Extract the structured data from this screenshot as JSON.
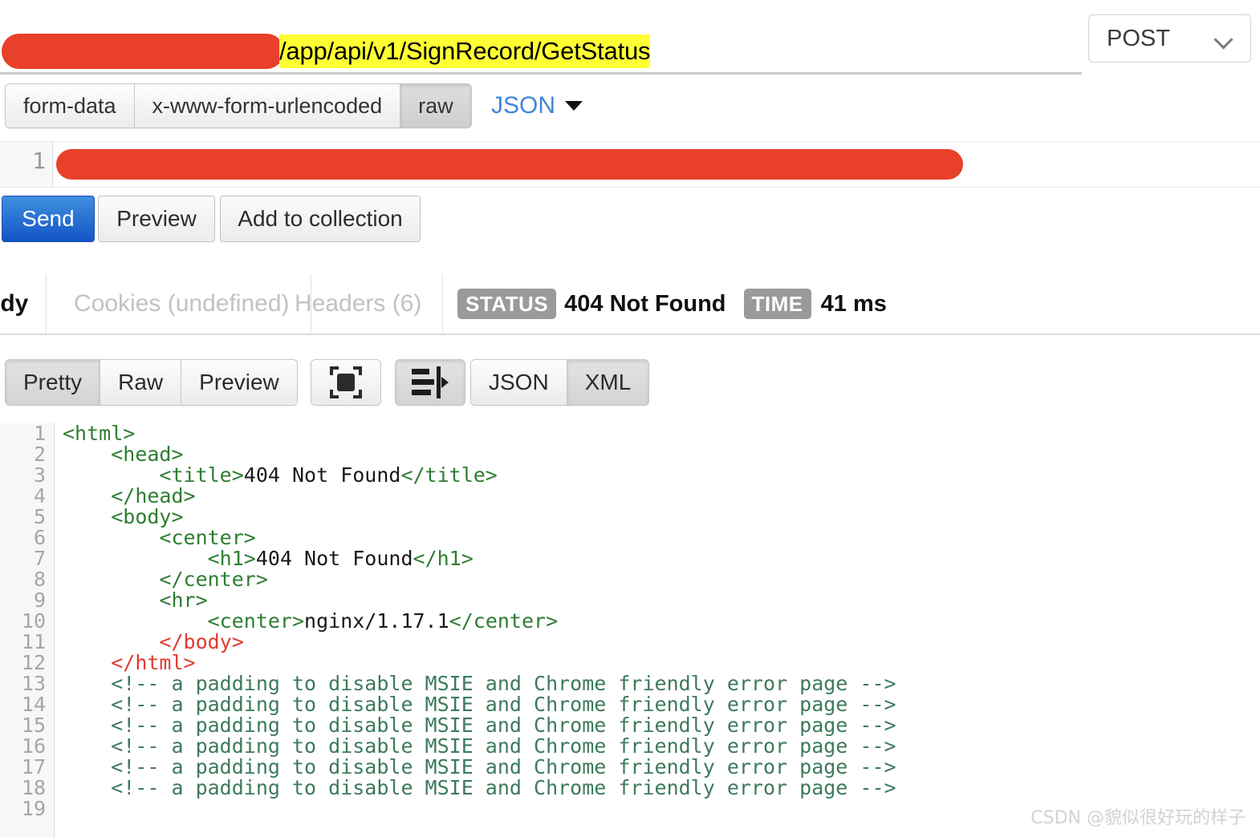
{
  "request": {
    "url_redacted": true,
    "url_visible_text": "/app/api/v1/SignRecord/GetStatus",
    "url_highlight_color": "#ffff33",
    "redaction_color": "#e8402a",
    "method": "POST",
    "method_chevron_icon": "chevron-down-icon",
    "body_type_tabs": [
      {
        "label": "form-data",
        "active": false
      },
      {
        "label": "x-www-form-urlencoded",
        "active": false
      },
      {
        "label": "raw",
        "active": true
      }
    ],
    "raw_format": {
      "label": "JSON",
      "color": "#3f87d8",
      "caret_icon": "caret-down-icon"
    },
    "body_editor": {
      "line_numbers": [
        "1"
      ],
      "content_redacted": true
    },
    "actions": [
      {
        "label": "Send",
        "style": "primary"
      },
      {
        "label": "Preview",
        "style": "secondary"
      },
      {
        "label": "Add to collection",
        "style": "secondary"
      }
    ]
  },
  "response": {
    "tabs": [
      {
        "label": "Body",
        "clipped_label": "ody",
        "active": true,
        "muted": false
      },
      {
        "label": "Cookies (undefined)",
        "active": false,
        "muted": true
      },
      {
        "label": "Headers (6)",
        "active": false,
        "muted": true
      }
    ],
    "status": {
      "badge": "STATUS",
      "value": "404 Not Found",
      "badge_color": "#9a9a9a"
    },
    "time": {
      "badge": "TIME",
      "value": "41 ms",
      "badge_color": "#9a9a9a"
    },
    "toolbar": {
      "view_modes": [
        {
          "label": "Pretty",
          "active": true
        },
        {
          "label": "Raw",
          "active": false
        },
        {
          "label": "Preview",
          "active": false
        }
      ],
      "fullscreen_button": {
        "icon": "fullscreen-icon",
        "active": false
      },
      "wrap_button": {
        "icon": "text-wrap-icon",
        "active": true
      },
      "formats": [
        {
          "label": "JSON",
          "active": false
        },
        {
          "label": "XML",
          "active": true
        }
      ]
    },
    "code": {
      "language": "html",
      "line_numbers": [
        "1",
        "2",
        "3",
        "4",
        "5",
        "6",
        "7",
        "8",
        "9",
        "10",
        "11",
        "12",
        "13",
        "14",
        "15",
        "16",
        "17",
        "18",
        "19"
      ],
      "lines": [
        {
          "n": 1,
          "indent": 0,
          "parts": [
            {
              "t": "tag",
              "s": "<html>"
            }
          ]
        },
        {
          "n": 2,
          "indent": 1,
          "parts": [
            {
              "t": "tag",
              "s": "<head>"
            }
          ]
        },
        {
          "n": 3,
          "indent": 2,
          "parts": [
            {
              "t": "tag",
              "s": "<title>"
            },
            {
              "t": "txt",
              "s": "404 Not Found"
            },
            {
              "t": "tag",
              "s": "</title>"
            }
          ]
        },
        {
          "n": 4,
          "indent": 1,
          "parts": [
            {
              "t": "tag",
              "s": "</head>"
            }
          ]
        },
        {
          "n": 5,
          "indent": 1,
          "parts": [
            {
              "t": "tag",
              "s": "<body>"
            }
          ]
        },
        {
          "n": 6,
          "indent": 2,
          "parts": [
            {
              "t": "tag",
              "s": "<center>"
            }
          ]
        },
        {
          "n": 7,
          "indent": 3,
          "parts": [
            {
              "t": "tag",
              "s": "<h1>"
            },
            {
              "t": "txt",
              "s": "404 Not Found"
            },
            {
              "t": "tag",
              "s": "</h1>"
            }
          ]
        },
        {
          "n": 8,
          "indent": 2,
          "parts": [
            {
              "t": "tag",
              "s": "</center>"
            }
          ]
        },
        {
          "n": 9,
          "indent": 2,
          "parts": [
            {
              "t": "tag",
              "s": "<hr>"
            }
          ]
        },
        {
          "n": 10,
          "indent": 3,
          "parts": [
            {
              "t": "tag",
              "s": "<center>"
            },
            {
              "t": "txt",
              "s": "nginx/1.17.1"
            },
            {
              "t": "tag",
              "s": "</center>"
            }
          ]
        },
        {
          "n": 11,
          "indent": 2,
          "parts": [
            {
              "t": "err",
              "s": "</body>"
            }
          ]
        },
        {
          "n": 12,
          "indent": 1,
          "parts": [
            {
              "t": "err",
              "s": "</html>"
            }
          ]
        },
        {
          "n": 13,
          "indent": 1,
          "parts": [
            {
              "t": "cmt",
              "s": "<!-- a padding to disable MSIE and Chrome friendly error page -->"
            }
          ]
        },
        {
          "n": 14,
          "indent": 1,
          "parts": [
            {
              "t": "cmt",
              "s": "<!-- a padding to disable MSIE and Chrome friendly error page -->"
            }
          ]
        },
        {
          "n": 15,
          "indent": 1,
          "parts": [
            {
              "t": "cmt",
              "s": "<!-- a padding to disable MSIE and Chrome friendly error page -->"
            }
          ]
        },
        {
          "n": 16,
          "indent": 1,
          "parts": [
            {
              "t": "cmt",
              "s": "<!-- a padding to disable MSIE and Chrome friendly error page -->"
            }
          ]
        },
        {
          "n": 17,
          "indent": 1,
          "parts": [
            {
              "t": "cmt",
              "s": "<!-- a padding to disable MSIE and Chrome friendly error page -->"
            }
          ]
        },
        {
          "n": 18,
          "indent": 1,
          "parts": [
            {
              "t": "cmt",
              "s": "<!-- a padding to disable MSIE and Chrome friendly error page -->"
            }
          ]
        },
        {
          "n": 19,
          "indent": 0,
          "parts": []
        }
      ]
    }
  },
  "watermark": "CSDN @貌似很好玩的样子"
}
